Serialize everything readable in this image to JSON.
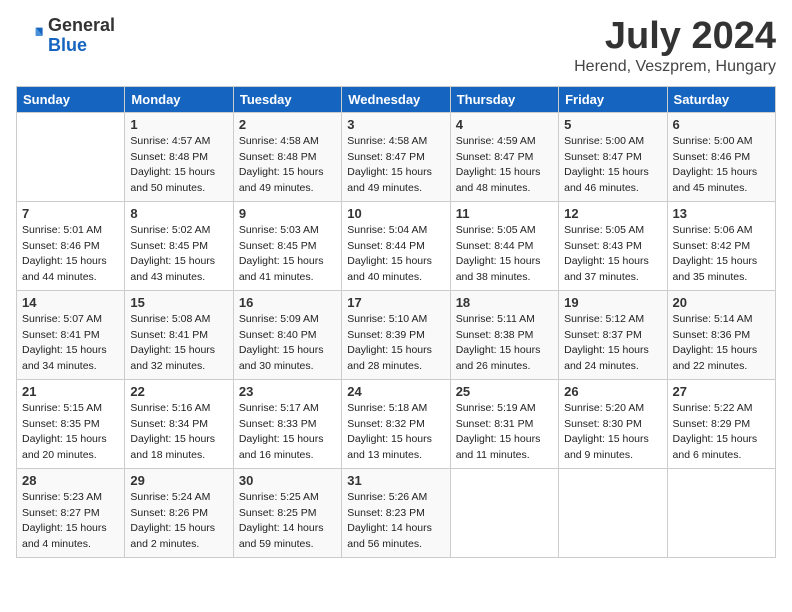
{
  "header": {
    "logo_general": "General",
    "logo_blue": "Blue",
    "month_title": "July 2024",
    "location": "Herend, Veszprem, Hungary"
  },
  "days_of_week": [
    "Sunday",
    "Monday",
    "Tuesday",
    "Wednesday",
    "Thursday",
    "Friday",
    "Saturday"
  ],
  "weeks": [
    [
      {
        "day": "",
        "data": ""
      },
      {
        "day": "1",
        "data": "Sunrise: 4:57 AM\nSunset: 8:48 PM\nDaylight: 15 hours\nand 50 minutes."
      },
      {
        "day": "2",
        "data": "Sunrise: 4:58 AM\nSunset: 8:48 PM\nDaylight: 15 hours\nand 49 minutes."
      },
      {
        "day": "3",
        "data": "Sunrise: 4:58 AM\nSunset: 8:47 PM\nDaylight: 15 hours\nand 49 minutes."
      },
      {
        "day": "4",
        "data": "Sunrise: 4:59 AM\nSunset: 8:47 PM\nDaylight: 15 hours\nand 48 minutes."
      },
      {
        "day": "5",
        "data": "Sunrise: 5:00 AM\nSunset: 8:47 PM\nDaylight: 15 hours\nand 46 minutes."
      },
      {
        "day": "6",
        "data": "Sunrise: 5:00 AM\nSunset: 8:46 PM\nDaylight: 15 hours\nand 45 minutes."
      }
    ],
    [
      {
        "day": "7",
        "data": "Sunrise: 5:01 AM\nSunset: 8:46 PM\nDaylight: 15 hours\nand 44 minutes."
      },
      {
        "day": "8",
        "data": "Sunrise: 5:02 AM\nSunset: 8:45 PM\nDaylight: 15 hours\nand 43 minutes."
      },
      {
        "day": "9",
        "data": "Sunrise: 5:03 AM\nSunset: 8:45 PM\nDaylight: 15 hours\nand 41 minutes."
      },
      {
        "day": "10",
        "data": "Sunrise: 5:04 AM\nSunset: 8:44 PM\nDaylight: 15 hours\nand 40 minutes."
      },
      {
        "day": "11",
        "data": "Sunrise: 5:05 AM\nSunset: 8:44 PM\nDaylight: 15 hours\nand 38 minutes."
      },
      {
        "day": "12",
        "data": "Sunrise: 5:05 AM\nSunset: 8:43 PM\nDaylight: 15 hours\nand 37 minutes."
      },
      {
        "day": "13",
        "data": "Sunrise: 5:06 AM\nSunset: 8:42 PM\nDaylight: 15 hours\nand 35 minutes."
      }
    ],
    [
      {
        "day": "14",
        "data": "Sunrise: 5:07 AM\nSunset: 8:41 PM\nDaylight: 15 hours\nand 34 minutes."
      },
      {
        "day": "15",
        "data": "Sunrise: 5:08 AM\nSunset: 8:41 PM\nDaylight: 15 hours\nand 32 minutes."
      },
      {
        "day": "16",
        "data": "Sunrise: 5:09 AM\nSunset: 8:40 PM\nDaylight: 15 hours\nand 30 minutes."
      },
      {
        "day": "17",
        "data": "Sunrise: 5:10 AM\nSunset: 8:39 PM\nDaylight: 15 hours\nand 28 minutes."
      },
      {
        "day": "18",
        "data": "Sunrise: 5:11 AM\nSunset: 8:38 PM\nDaylight: 15 hours\nand 26 minutes."
      },
      {
        "day": "19",
        "data": "Sunrise: 5:12 AM\nSunset: 8:37 PM\nDaylight: 15 hours\nand 24 minutes."
      },
      {
        "day": "20",
        "data": "Sunrise: 5:14 AM\nSunset: 8:36 PM\nDaylight: 15 hours\nand 22 minutes."
      }
    ],
    [
      {
        "day": "21",
        "data": "Sunrise: 5:15 AM\nSunset: 8:35 PM\nDaylight: 15 hours\nand 20 minutes."
      },
      {
        "day": "22",
        "data": "Sunrise: 5:16 AM\nSunset: 8:34 PM\nDaylight: 15 hours\nand 18 minutes."
      },
      {
        "day": "23",
        "data": "Sunrise: 5:17 AM\nSunset: 8:33 PM\nDaylight: 15 hours\nand 16 minutes."
      },
      {
        "day": "24",
        "data": "Sunrise: 5:18 AM\nSunset: 8:32 PM\nDaylight: 15 hours\nand 13 minutes."
      },
      {
        "day": "25",
        "data": "Sunrise: 5:19 AM\nSunset: 8:31 PM\nDaylight: 15 hours\nand 11 minutes."
      },
      {
        "day": "26",
        "data": "Sunrise: 5:20 AM\nSunset: 8:30 PM\nDaylight: 15 hours\nand 9 minutes."
      },
      {
        "day": "27",
        "data": "Sunrise: 5:22 AM\nSunset: 8:29 PM\nDaylight: 15 hours\nand 6 minutes."
      }
    ],
    [
      {
        "day": "28",
        "data": "Sunrise: 5:23 AM\nSunset: 8:27 PM\nDaylight: 15 hours\nand 4 minutes."
      },
      {
        "day": "29",
        "data": "Sunrise: 5:24 AM\nSunset: 8:26 PM\nDaylight: 15 hours\nand 2 minutes."
      },
      {
        "day": "30",
        "data": "Sunrise: 5:25 AM\nSunset: 8:25 PM\nDaylight: 14 hours\nand 59 minutes."
      },
      {
        "day": "31",
        "data": "Sunrise: 5:26 AM\nSunset: 8:23 PM\nDaylight: 14 hours\nand 56 minutes."
      },
      {
        "day": "",
        "data": ""
      },
      {
        "day": "",
        "data": ""
      },
      {
        "day": "",
        "data": ""
      }
    ]
  ]
}
